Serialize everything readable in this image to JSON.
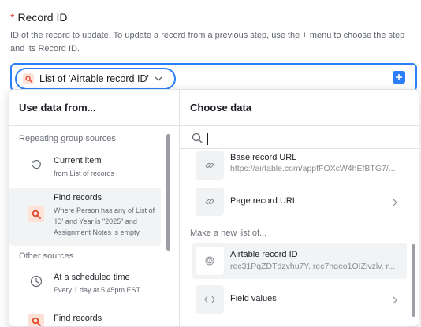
{
  "field": {
    "required_mark": "*",
    "label": "Record ID",
    "help": "ID of the record to update. To update a record from a previous step, use the + menu to choose the step and its Record ID."
  },
  "input": {
    "token_label": "List of 'Airtable record ID'"
  },
  "left_panel": {
    "title": "Use data from...",
    "sections": [
      {
        "heading": "Repeating group sources",
        "items": [
          {
            "title": "Current item",
            "subtitle": "from List of records",
            "icon": "loop-icon"
          },
          {
            "title": "Find records",
            "subtitle": "Where Person has any of List of 'ID' and Year is \"2025\" and Assignment Notes is empty",
            "icon": "search-icon"
          }
        ]
      },
      {
        "heading": "Other sources",
        "items": [
          {
            "title": "At a scheduled time",
            "subtitle": "Every 1 day at 5:45pm EST",
            "icon": "clock-icon"
          },
          {
            "title": "Find records",
            "subtitle": "",
            "icon": "search-icon"
          }
        ]
      }
    ]
  },
  "right_panel": {
    "title": "Choose data",
    "items_top": [
      {
        "title": "Base record URL",
        "subtitle": "https://airtable.com/appfFOXcW4hEfBTG7/...",
        "icon": "link-icon"
      },
      {
        "title": "Page record URL",
        "subtitle": "",
        "icon": "link-icon"
      }
    ],
    "new_list_heading": "Make a new list of...",
    "items_bottom": [
      {
        "title": "Airtable record ID",
        "subtitle": "rec31PqZDTdzvhu7Y, rec7hqeo1OIZivzlv, r...",
        "icon": "fingerprint-icon"
      },
      {
        "title": "Field values",
        "subtitle": "",
        "icon": "code-brackets-icon"
      }
    ]
  },
  "colors": {
    "accent": "#2d7ff9",
    "required": "#e0453a",
    "source_icon_bg": "#fde2d7",
    "source_icon_fg": "#e0452c"
  }
}
